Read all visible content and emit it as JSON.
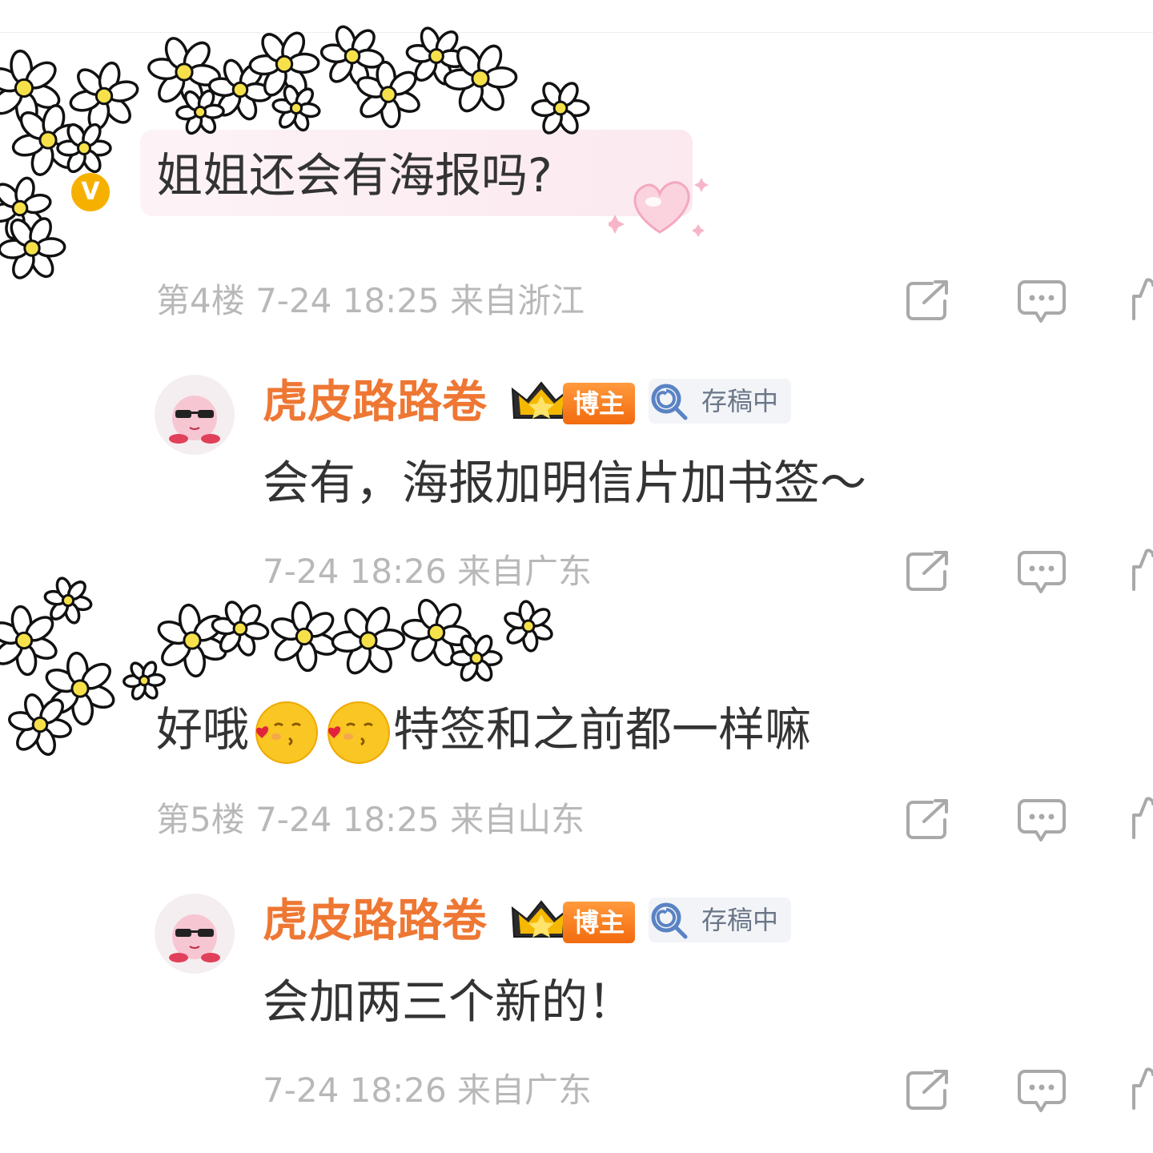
{
  "comments": [
    {
      "text": "姐姐还会有海报吗?",
      "meta": "第4楼 7-24 18:25 来自浙江",
      "verified_mark": "V"
    },
    {
      "author": "虎皮路路卷",
      "badge_blogger": "博主",
      "badge_status": "存稿中",
      "text": "会有，海报加明信片加书签～",
      "meta": "7-24 18:26 来自广东"
    },
    {
      "text_before": "好哦",
      "text_after": "特签和之前都一样嘛",
      "meta": "第5楼 7-24 18:25 来自山东"
    },
    {
      "author": "虎皮路路卷",
      "badge_blogger": "博主",
      "badge_status": "存稿中",
      "text": "会加两三个新的！",
      "meta": "7-24 18:26 来自广东"
    }
  ],
  "icons": {
    "share": "share-icon",
    "comment": "comment-icon",
    "like": "like-icon",
    "crown": "crown-icon",
    "lollipop": "lollipop-icon",
    "kiss_emoji": "kiss-emoji-icon",
    "heart_sticker": "heart-sticker-icon",
    "flower": "daisy-icon"
  },
  "colors": {
    "author_name": "#ee7733",
    "meta_text": "#b8b8b8",
    "body_text": "#333333",
    "bubble": "#fbe9ef",
    "blogger_badge": "#f26b0e"
  }
}
